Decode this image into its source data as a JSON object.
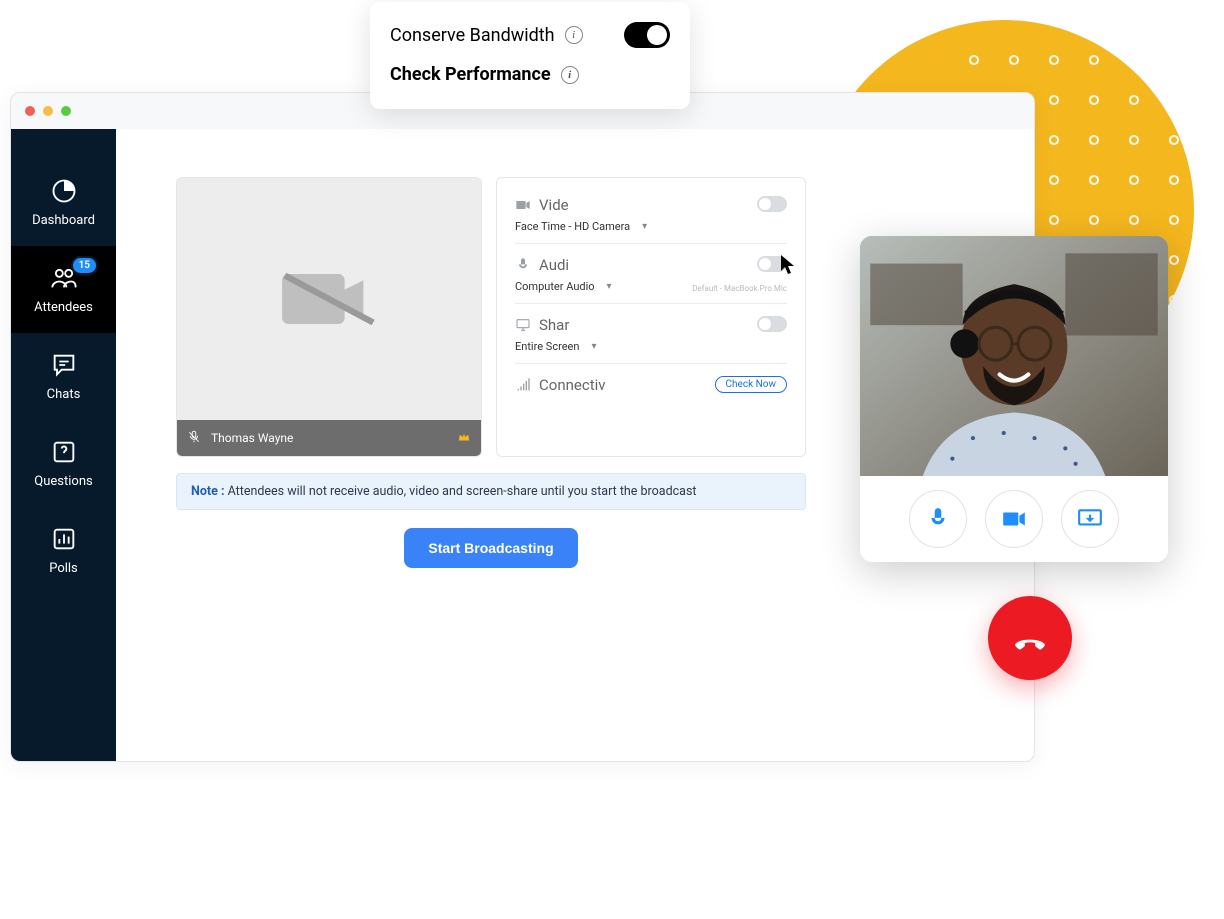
{
  "topCard": {
    "conserve_label": "Conserve Bandwidth",
    "check_label": "Check Performance"
  },
  "sidebar": {
    "items": [
      {
        "label": "Dashboard"
      },
      {
        "label": "Attendees",
        "badge": "15"
      },
      {
        "label": "Chats"
      },
      {
        "label": "Questions"
      },
      {
        "label": "Polls"
      }
    ]
  },
  "preview": {
    "participant_name": "Thomas Wayne"
  },
  "settings": {
    "video": {
      "title": "Vide",
      "source": "Face Time - HD Camera"
    },
    "audio": {
      "title": "Audi",
      "source": "Computer Audio",
      "default_note": "Default - MacBook Pro Mic"
    },
    "share": {
      "title": "Shar",
      "source": "Entire Screen"
    },
    "connectivity": {
      "title": "Connectiv",
      "check_label": "Check Now"
    }
  },
  "note": {
    "prefix": "Note :",
    "text": " Attendees will not receive audio, video and screen-share until you start the broadcast"
  },
  "broadcast_button": "Start Broadcasting"
}
